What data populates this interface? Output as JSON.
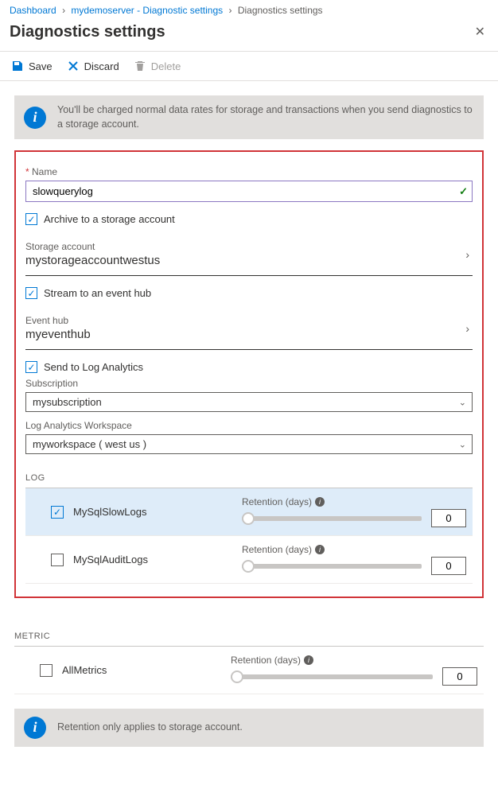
{
  "breadcrumb": {
    "item0": "Dashboard",
    "item1": "mydemoserver - Diagnostic settings",
    "item2": "Diagnostics settings"
  },
  "title": "Diagnostics settings",
  "toolbar": {
    "save": "Save",
    "discard": "Discard",
    "delete": "Delete"
  },
  "banner_top": "You'll be charged normal data rates for storage and transactions when you send diagnostics to a storage account.",
  "name": {
    "label": "Name",
    "value": "slowquerylog"
  },
  "archive": {
    "label": "Archive to a storage account",
    "storage_label": "Storage account",
    "storage_value": "mystorageaccountwestus"
  },
  "stream": {
    "label": "Stream to an event hub",
    "hub_label": "Event hub",
    "hub_value": "myeventhub"
  },
  "log_analytics": {
    "label": "Send to Log Analytics",
    "sub_label": "Subscription",
    "sub_value": "mysubscription",
    "ws_label": "Log Analytics Workspace",
    "ws_value": "myworkspace ( west us )"
  },
  "section_log": "LOG",
  "section_metric": "METRIC",
  "retention_label": "Retention (days)",
  "logs": [
    {
      "name": "MySqlSlowLogs",
      "checked": true,
      "retention": "0"
    },
    {
      "name": "MySqlAuditLogs",
      "checked": false,
      "retention": "0"
    }
  ],
  "metrics": [
    {
      "name": "AllMetrics",
      "checked": false,
      "retention": "0"
    }
  ],
  "banner_bottom": "Retention only applies to storage account."
}
